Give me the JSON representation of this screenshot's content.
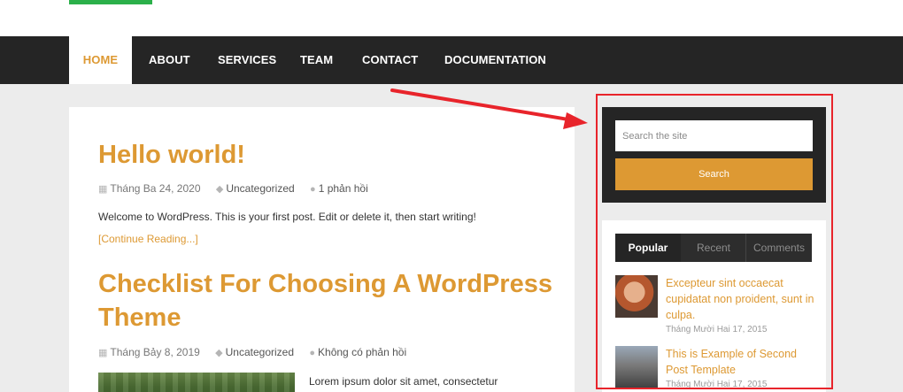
{
  "nav": {
    "items": [
      {
        "label": "HOME"
      },
      {
        "label": "ABOUT"
      },
      {
        "label": "SERVICES"
      },
      {
        "label": "TEAM"
      },
      {
        "label": "CONTACT"
      },
      {
        "label": "DOCUMENTATION"
      }
    ]
  },
  "posts": [
    {
      "title": "Hello world!",
      "date": "Tháng Ba 24, 2020",
      "category": "Uncategorized",
      "comments": "1 phản hồi",
      "excerpt": "Welcome to WordPress. This is your first post. Edit or delete it, then start writing!",
      "read_more": "[Continue Reading...]"
    },
    {
      "title_line1": "Checklist For Choosing A WordPress",
      "title_line2": "Theme",
      "date": "Tháng Bảy 8, 2019",
      "category": "Uncategorized",
      "comments": "Không có phản hồi",
      "excerpt": "Lorem ipsum dolor sit amet, consectetur"
    }
  ],
  "search": {
    "placeholder": "Search the site",
    "button_label": "Search"
  },
  "tabs": [
    {
      "label": "Popular"
    },
    {
      "label": "Recent"
    },
    {
      "label": "Comments"
    }
  ],
  "popular_posts": [
    {
      "title": "Excepteur sint occaecat cupidatat non proident, sunt in culpa.",
      "date": "Tháng Mười Hai 17, 2015"
    },
    {
      "title": "This is Example of Second Post Template",
      "date": "Tháng Mười Hai 17, 2015"
    }
  ],
  "colors": {
    "accent": "#dd9933",
    "nav_bg": "#252525",
    "annotation": "#e8242b"
  }
}
